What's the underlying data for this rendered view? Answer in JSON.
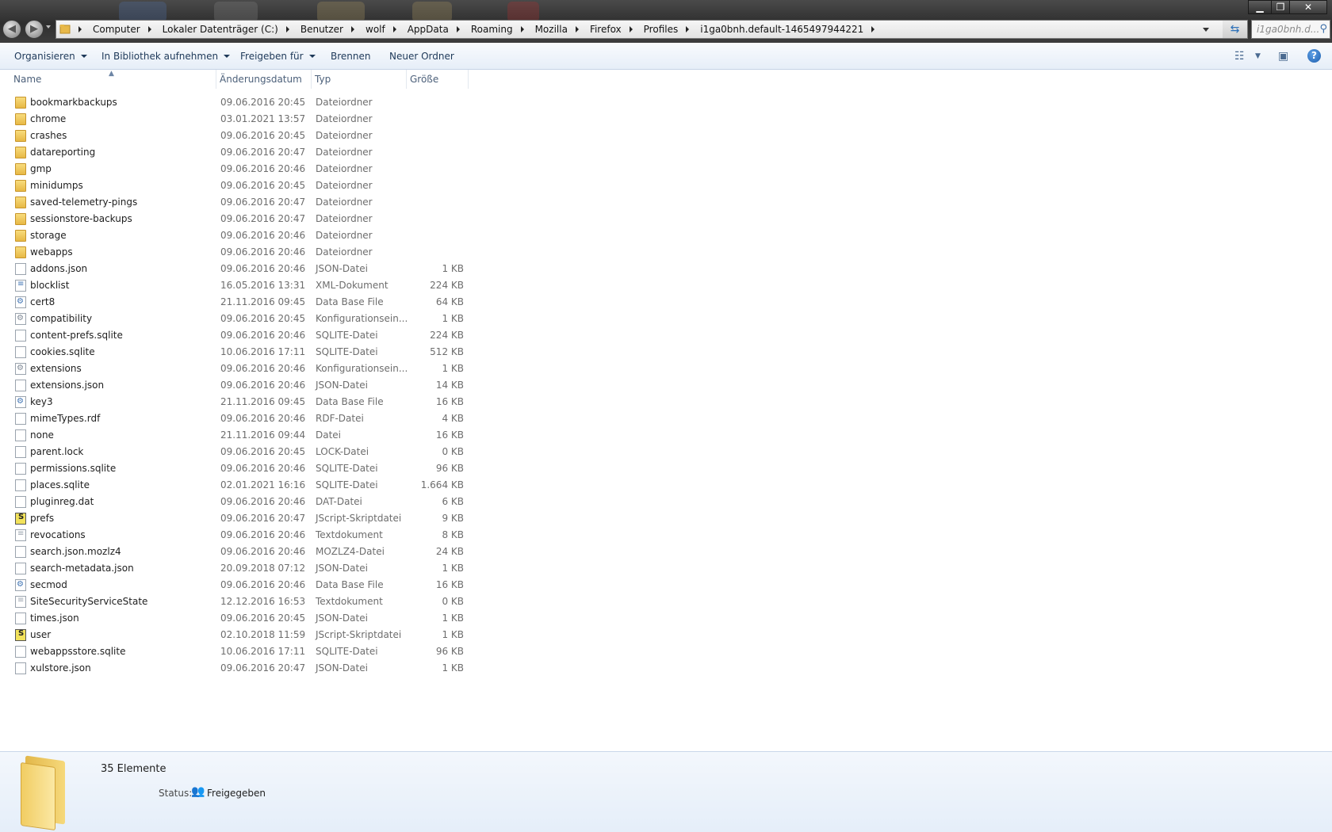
{
  "window": {
    "minimize": "▁",
    "maximize": "❐",
    "close": "✕"
  },
  "address": {
    "crumbs": [
      "Computer",
      "Lokaler Datenträger (C:)",
      "Benutzer",
      "wolf",
      "AppData",
      "Roaming",
      "Mozilla",
      "Firefox",
      "Profiles",
      "i1ga0bnh.default-1465497944221"
    ],
    "search_text": "i1ga0bnh.d..."
  },
  "toolbar": {
    "organize": "Organisieren",
    "library": "In Bibliothek aufnehmen",
    "share": "Freigeben für",
    "burn": "Brennen",
    "new_folder": "Neuer Ordner"
  },
  "columns": {
    "name": "Name",
    "date": "Änderungsdatum",
    "type": "Typ",
    "size": "Größe"
  },
  "files": [
    {
      "name": "bookmarkbackups",
      "date": "09.06.2016 20:45",
      "type": "Dateiordner",
      "size": "",
      "icon": "folder"
    },
    {
      "name": "chrome",
      "date": "03.01.2021 13:57",
      "type": "Dateiordner",
      "size": "",
      "icon": "folder"
    },
    {
      "name": "crashes",
      "date": "09.06.2016 20:45",
      "type": "Dateiordner",
      "size": "",
      "icon": "folder"
    },
    {
      "name": "datareporting",
      "date": "09.06.2016 20:47",
      "type": "Dateiordner",
      "size": "",
      "icon": "folder"
    },
    {
      "name": "gmp",
      "date": "09.06.2016 20:46",
      "type": "Dateiordner",
      "size": "",
      "icon": "folder"
    },
    {
      "name": "minidumps",
      "date": "09.06.2016 20:45",
      "type": "Dateiordner",
      "size": "",
      "icon": "folder"
    },
    {
      "name": "saved-telemetry-pings",
      "date": "09.06.2016 20:47",
      "type": "Dateiordner",
      "size": "",
      "icon": "folder"
    },
    {
      "name": "sessionstore-backups",
      "date": "09.06.2016 20:47",
      "type": "Dateiordner",
      "size": "",
      "icon": "folder"
    },
    {
      "name": "storage",
      "date": "09.06.2016 20:46",
      "type": "Dateiordner",
      "size": "",
      "icon": "folder"
    },
    {
      "name": "webapps",
      "date": "09.06.2016 20:46",
      "type": "Dateiordner",
      "size": "",
      "icon": "folder"
    },
    {
      "name": "addons.json",
      "date": "09.06.2016 20:46",
      "type": "JSON-Datei",
      "size": "1 KB",
      "icon": "file"
    },
    {
      "name": "blocklist",
      "date": "16.05.2016 13:31",
      "type": "XML-Dokument",
      "size": "224 KB",
      "icon": "xml"
    },
    {
      "name": "cert8",
      "date": "21.11.2016 09:45",
      "type": "Data Base File",
      "size": "64 KB",
      "icon": "db"
    },
    {
      "name": "compatibility",
      "date": "09.06.2016 20:45",
      "type": "Konfigurationsein...",
      "size": "1 KB",
      "icon": "cfg"
    },
    {
      "name": "content-prefs.sqlite",
      "date": "09.06.2016 20:46",
      "type": "SQLITE-Datei",
      "size": "224 KB",
      "icon": "file"
    },
    {
      "name": "cookies.sqlite",
      "date": "10.06.2016 17:11",
      "type": "SQLITE-Datei",
      "size": "512 KB",
      "icon": "file"
    },
    {
      "name": "extensions",
      "date": "09.06.2016 20:46",
      "type": "Konfigurationsein...",
      "size": "1 KB",
      "icon": "cfg"
    },
    {
      "name": "extensions.json",
      "date": "09.06.2016 20:46",
      "type": "JSON-Datei",
      "size": "14 KB",
      "icon": "file"
    },
    {
      "name": "key3",
      "date": "21.11.2016 09:45",
      "type": "Data Base File",
      "size": "16 KB",
      "icon": "db"
    },
    {
      "name": "mimeTypes.rdf",
      "date": "09.06.2016 20:46",
      "type": "RDF-Datei",
      "size": "4 KB",
      "icon": "file"
    },
    {
      "name": "none",
      "date": "21.11.2016 09:44",
      "type": "Datei",
      "size": "16 KB",
      "icon": "file"
    },
    {
      "name": "parent.lock",
      "date": "09.06.2016 20:45",
      "type": "LOCK-Datei",
      "size": "0 KB",
      "icon": "file"
    },
    {
      "name": "permissions.sqlite",
      "date": "09.06.2016 20:46",
      "type": "SQLITE-Datei",
      "size": "96 KB",
      "icon": "file"
    },
    {
      "name": "places.sqlite",
      "date": "02.01.2021 16:16",
      "type": "SQLITE-Datei",
      "size": "1.664 KB",
      "icon": "file"
    },
    {
      "name": "pluginreg.dat",
      "date": "09.06.2016 20:46",
      "type": "DAT-Datei",
      "size": "6 KB",
      "icon": "file"
    },
    {
      "name": "prefs",
      "date": "09.06.2016 20:47",
      "type": "JScript-Skriptdatei",
      "size": "9 KB",
      "icon": "js"
    },
    {
      "name": "revocations",
      "date": "09.06.2016 20:46",
      "type": "Textdokument",
      "size": "8 KB",
      "icon": "txt"
    },
    {
      "name": "search.json.mozlz4",
      "date": "09.06.2016 20:46",
      "type": "MOZLZ4-Datei",
      "size": "24 KB",
      "icon": "file"
    },
    {
      "name": "search-metadata.json",
      "date": "20.09.2018 07:12",
      "type": "JSON-Datei",
      "size": "1 KB",
      "icon": "file"
    },
    {
      "name": "secmod",
      "date": "09.06.2016 20:46",
      "type": "Data Base File",
      "size": "16 KB",
      "icon": "db"
    },
    {
      "name": "SiteSecurityServiceState",
      "date": "12.12.2016 16:53",
      "type": "Textdokument",
      "size": "0 KB",
      "icon": "txt"
    },
    {
      "name": "times.json",
      "date": "09.06.2016 20:45",
      "type": "JSON-Datei",
      "size": "1 KB",
      "icon": "file"
    },
    {
      "name": "user",
      "date": "02.10.2018 11:59",
      "type": "JScript-Skriptdatei",
      "size": "1 KB",
      "icon": "js"
    },
    {
      "name": "webappsstore.sqlite",
      "date": "10.06.2016 17:11",
      "type": "SQLITE-Datei",
      "size": "96 KB",
      "icon": "file"
    },
    {
      "name": "xulstore.json",
      "date": "09.06.2016 20:47",
      "type": "JSON-Datei",
      "size": "1 KB",
      "icon": "file"
    }
  ],
  "details": {
    "count": "35 Elemente",
    "status_label": "Status:",
    "status_value": "Freigegeben"
  }
}
